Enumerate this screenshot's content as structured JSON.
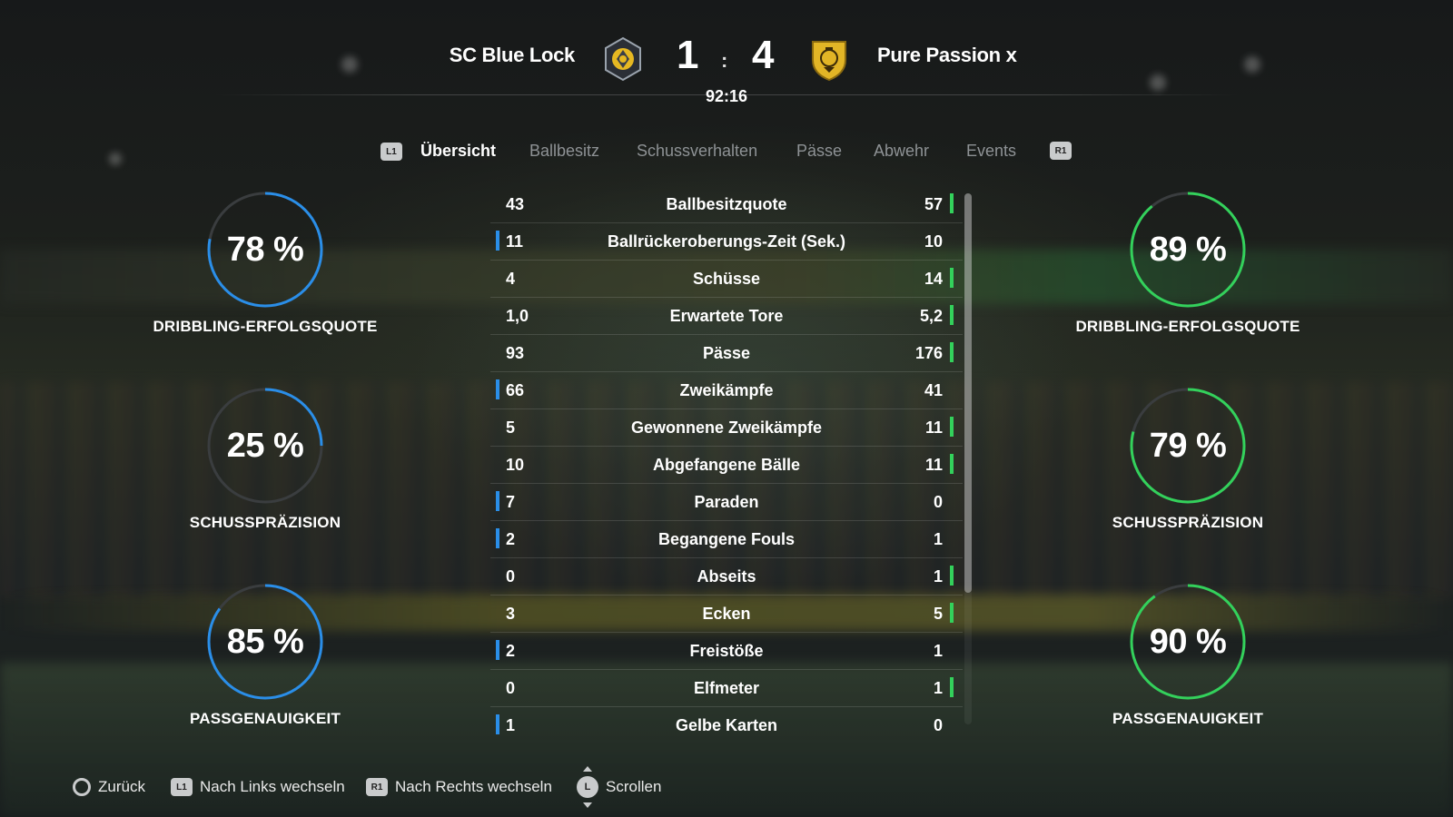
{
  "header": {
    "home_team": "SC Blue Lock",
    "away_team": "Pure Passion x",
    "home_score": "1",
    "away_score": "4",
    "separator": ":",
    "clock": "92:16"
  },
  "tabs": {
    "left_button": "L1",
    "right_button": "R1",
    "items": [
      {
        "label": "Übersicht",
        "active": true
      },
      {
        "label": "Ballbesitz",
        "active": false
      },
      {
        "label": "Schussverhalten",
        "active": false
      },
      {
        "label": "Pässe",
        "active": false
      },
      {
        "label": "Abwehr",
        "active": false
      },
      {
        "label": "Events",
        "active": false
      }
    ]
  },
  "colors": {
    "home_accent": "#2a8ee8",
    "away_accent": "#33d15b",
    "gauge_track": "#3a3d3f"
  },
  "home_gauges": [
    {
      "value": "78 %",
      "percent": 78,
      "label": "DRIBBLING-ERFOLGSQUOTE"
    },
    {
      "value": "25 %",
      "percent": 25,
      "label": "SCHUSSPRÄZISION"
    },
    {
      "value": "85 %",
      "percent": 85,
      "label": "PASSGENAUIGKEIT"
    }
  ],
  "away_gauges": [
    {
      "value": "89 %",
      "percent": 89,
      "label": "DRIBBLING-ERFOLGSQUOTE"
    },
    {
      "value": "79 %",
      "percent": 79,
      "label": "SCHUSSPRÄZISION"
    },
    {
      "value": "90 %",
      "percent": 90,
      "label": "PASSGENAUIGKEIT"
    }
  ],
  "stats": [
    {
      "home": "43",
      "name": "Ballbesitzquote",
      "away": "57",
      "leader": "away"
    },
    {
      "home": "11",
      "name": "Ballrückeroberungs-Zeit (Sek.)",
      "away": "10",
      "leader": "home"
    },
    {
      "home": "4",
      "name": "Schüsse",
      "away": "14",
      "leader": "away"
    },
    {
      "home": "1,0",
      "name": "Erwartete Tore",
      "away": "5,2",
      "leader": "away"
    },
    {
      "home": "93",
      "name": "Pässe",
      "away": "176",
      "leader": "away"
    },
    {
      "home": "66",
      "name": "Zweikämpfe",
      "away": "41",
      "leader": "home"
    },
    {
      "home": "5",
      "name": "Gewonnene Zweikämpfe",
      "away": "11",
      "leader": "away"
    },
    {
      "home": "10",
      "name": "Abgefangene Bälle",
      "away": "11",
      "leader": "away"
    },
    {
      "home": "7",
      "name": "Paraden",
      "away": "0",
      "leader": "home"
    },
    {
      "home": "2",
      "name": "Begangene Fouls",
      "away": "1",
      "leader": "home"
    },
    {
      "home": "0",
      "name": "Abseits",
      "away": "1",
      "leader": "away"
    },
    {
      "home": "3",
      "name": "Ecken",
      "away": "5",
      "leader": "away"
    },
    {
      "home": "2",
      "name": "Freistöße",
      "away": "1",
      "leader": "home"
    },
    {
      "home": "0",
      "name": "Elfmeter",
      "away": "1",
      "leader": "away"
    },
    {
      "home": "1",
      "name": "Gelbe Karten",
      "away": "0",
      "leader": "home"
    }
  ],
  "footer": {
    "back": "Zurück",
    "left_button": "L1",
    "left": "Nach Links wechseln",
    "right_button": "R1",
    "right": "Nach Rechts wechseln",
    "stick": "L",
    "scroll": "Scrollen"
  }
}
